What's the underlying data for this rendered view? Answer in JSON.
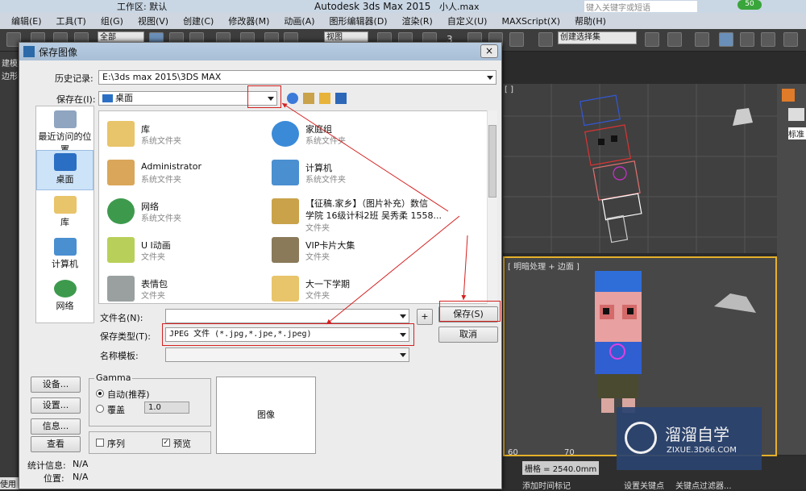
{
  "app": {
    "workspace_label": "工作区: 默认",
    "title": "Autodesk 3ds Max  2015",
    "file": "小人.max",
    "search_placeholder": "键入关键字或短语"
  },
  "menu": [
    "编辑(E)",
    "工具(T)",
    "组(G)",
    "视图(V)",
    "创建(C)",
    "修改器(M)",
    "动画(A)",
    "图形编辑器(D)",
    "渲染(R)",
    "自定义(U)",
    "MAXScript(X)",
    "帮助(H)"
  ],
  "toolbar": {
    "filter": "全部",
    "view": "视图",
    "selection_set": "创建选择集",
    "number": "3"
  },
  "viewport": {
    "top_label": "[ ]",
    "persp_label": "[ 明暗处理 + 边面 ]"
  },
  "dialog": {
    "title": "保存图像",
    "close": "×",
    "history_label": "历史记录:",
    "history_value": "E:\\3ds max 2015\\3DS MAX",
    "savein_label": "保存在(I):",
    "savein_value": "桌面",
    "places": [
      "最近访问的位置",
      "桌面",
      "库",
      "计算机",
      "网络"
    ],
    "files": [
      {
        "name": "库",
        "type": "系统文件夹"
      },
      {
        "name": "家庭组",
        "type": "系统文件夹"
      },
      {
        "name": "Administrator",
        "type": "系统文件夹"
      },
      {
        "name": "计算机",
        "type": "系统文件夹"
      },
      {
        "name": "网络",
        "type": "系统文件夹"
      },
      {
        "name": "【征稿.家乡】（图片补充）数信",
        "name2": "学院 16级计科2班 吴秀柔 1558...",
        "type": "文件夹"
      },
      {
        "name": "U I动画",
        "type": "文件夹"
      },
      {
        "name": "VIP卡片大集",
        "type": "文件夹"
      },
      {
        "name": "表情包",
        "type": "文件夹"
      },
      {
        "name": "大一下学期",
        "type": "文件夹"
      }
    ],
    "filename_label": "文件名(N):",
    "filename_value": "",
    "filetype_label": "保存类型(T):",
    "filetype_value": "JPEG 文件 (*.jpg,*.jpe,*.jpeg)",
    "template_label": "名称模板:",
    "plus_label": "+",
    "save_button": "保存(S)",
    "cancel_button": "取消",
    "setup_button": "设备...",
    "settings_button": "设置...",
    "info_button": "信息...",
    "view_button": "查看",
    "gamma_label": "Gamma",
    "gamma_auto": "自动(推荐)",
    "gamma_override": "覆盖",
    "gamma_value": "1.0",
    "sequence_label": "序列",
    "preview_label": "预览",
    "image_label": "图像",
    "stats_label": "统计信息:",
    "stats_value": "N/A",
    "location_label": "位置:",
    "location_value": "N/A"
  },
  "status": {
    "grid": "栅格 = 2540.0mm",
    "set_key": "设置关键点",
    "key_filter": "关键点过滤器...",
    "add_time_tag": "添加时间标记",
    "ruler_60": "60",
    "ruler_70": "70"
  },
  "watermark": {
    "brand": "溜溜自学",
    "url": "ZIXUE.3D66.COM"
  },
  "left_strip": {
    "build": "建模",
    "poly": "边形",
    "use": "使用"
  },
  "right_panel": {
    "label": "标准"
  }
}
